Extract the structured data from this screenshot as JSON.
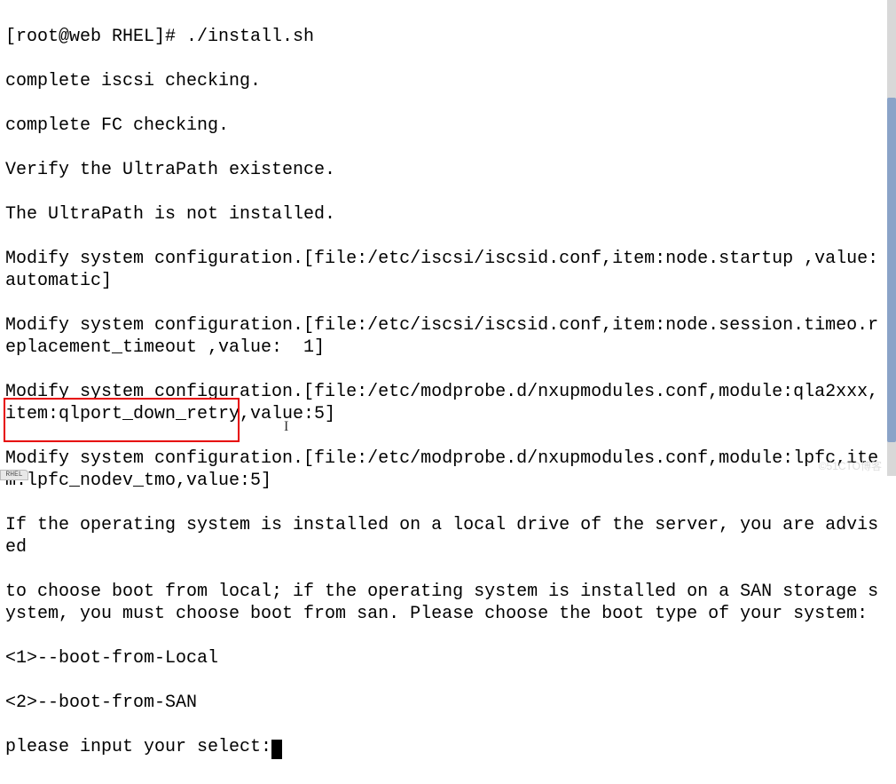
{
  "terminal": {
    "lines": [
      "[root@web RHEL]# ./install.sh",
      "complete iscsi checking.",
      "complete FC checking.",
      "Verify the UltraPath existence.",
      "The UltraPath is not installed.",
      "Modify system configuration.[file:/etc/iscsi/iscsid.conf,item:node.startup ,value:  automatic]",
      "Modify system configuration.[file:/etc/iscsi/iscsid.conf,item:node.session.timeo.replacement_timeout ,value:  1]",
      "Modify system configuration.[file:/etc/modprobe.d/nxupmodules.conf,module:qla2xxx,item:qlport_down_retry,value:5]",
      "Modify system configuration.[file:/etc/modprobe.d/nxupmodules.conf,module:lpfc,item:lpfc_nodev_tmo,value:5]",
      "If the operating system is installed on a local drive of the server, you are advised",
      "to choose boot from local; if the operating system is installed on a SAN storage system, you must choose boot from san. Please choose the boot type of your system:",
      "<1>--boot-from-Local",
      "<2>--boot-from-SAN"
    ],
    "prompt": "please input your select:"
  },
  "tab": {
    "label": "RHEL"
  },
  "watermark": "©51CTO博客"
}
